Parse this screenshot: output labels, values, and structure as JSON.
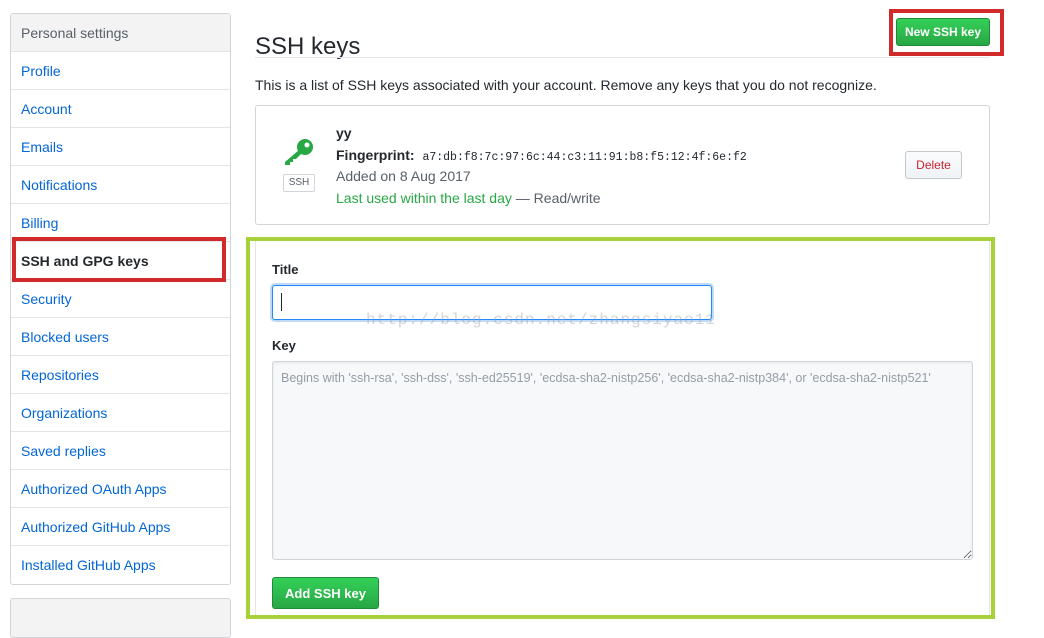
{
  "sidebar": {
    "header": "Personal settings",
    "items": [
      {
        "label": "Profile"
      },
      {
        "label": "Account"
      },
      {
        "label": "Emails"
      },
      {
        "label": "Notifications"
      },
      {
        "label": "Billing"
      },
      {
        "label": "SSH and GPG keys",
        "selected": true
      },
      {
        "label": "Security"
      },
      {
        "label": "Blocked users"
      },
      {
        "label": "Repositories"
      },
      {
        "label": "Organizations"
      },
      {
        "label": "Saved replies"
      },
      {
        "label": "Authorized OAuth Apps"
      },
      {
        "label": "Authorized GitHub Apps"
      },
      {
        "label": "Installed GitHub Apps"
      }
    ]
  },
  "main": {
    "title": "SSH keys",
    "new_key_button": "New SSH key",
    "intro": "This is a list of SSH keys associated with your account. Remove any keys that you do not recognize."
  },
  "key": {
    "type_label": "SSH",
    "name": "yy",
    "fingerprint_label": "Fingerprint:",
    "fingerprint": "a7:db:f8:7c:97:6c:44:c3:11:91:b8:f5:12:4f:6e:f2",
    "added": "Added on 8 Aug 2017",
    "last_used": "Last used within the last day",
    "access": " — Read/write",
    "delete_button": "Delete",
    "icon": "key-icon"
  },
  "form": {
    "title_label": "Title",
    "title_value": "",
    "key_label": "Key",
    "key_placeholder": "Begins with 'ssh-rsa', 'ssh-dss', 'ssh-ed25519', 'ecdsa-sha2-nistp256', 'ecdsa-sha2-nistp384', or 'ecdsa-sha2-nistp521'",
    "submit_button": "Add SSH key"
  },
  "watermark": "http://blog.csdn.net/zhangsiyao11",
  "colors": {
    "link": "#0366d6",
    "green": "#28a745",
    "danger": "#cb2431",
    "highlight_red": "#d02a2a",
    "highlight_green": "#a6d13a"
  }
}
